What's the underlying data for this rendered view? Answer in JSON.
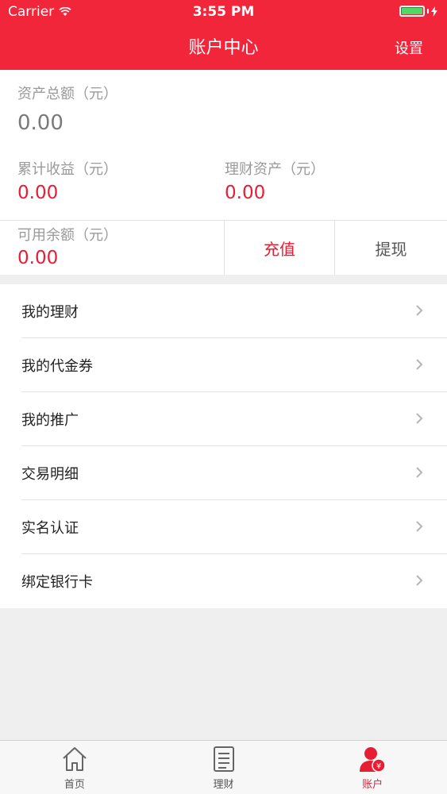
{
  "status_bar": {
    "carrier": "Carrier",
    "time": "3:55 PM"
  },
  "nav": {
    "title": "账户中心",
    "settings": "设置"
  },
  "summary": {
    "total_assets_label": "资产总额（元）",
    "total_assets_value": "0.00",
    "cumulative_income_label": "累计收益（元）",
    "cumulative_income_value": "0.00",
    "wealth_assets_label": "理财资产（元）",
    "wealth_assets_value": "0.00",
    "available_balance_label": "可用余额（元）",
    "available_balance_value": "0.00",
    "recharge_label": "充值",
    "withdraw_label": "提现"
  },
  "menu": {
    "items": [
      {
        "label": "我的理财"
      },
      {
        "label": "我的代金券"
      },
      {
        "label": "我的推广"
      },
      {
        "label": "交易明细"
      },
      {
        "label": "实名认证"
      },
      {
        "label": "绑定银行卡"
      }
    ]
  },
  "tabbar": {
    "items": [
      {
        "label": "首页",
        "icon": "home-icon"
      },
      {
        "label": "理财",
        "icon": "list-icon"
      },
      {
        "label": "账户",
        "icon": "account-icon"
      }
    ],
    "active_index": 2
  },
  "colors": {
    "brand": "#f2263a",
    "accent_text": "#e61e34",
    "battery": "#4cd964"
  }
}
